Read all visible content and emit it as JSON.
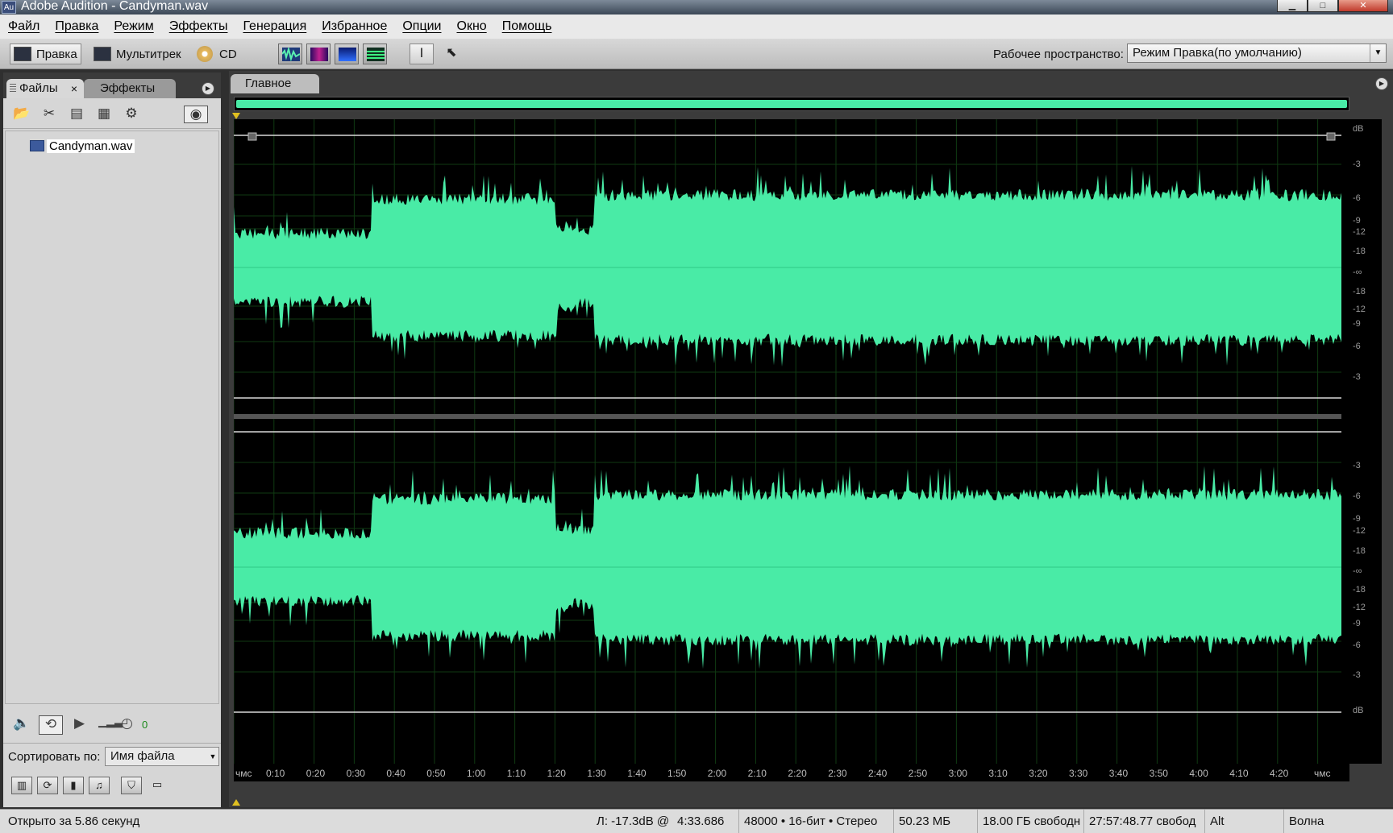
{
  "window": {
    "app_icon": "Au",
    "title": "Adobe Audition - Candyman.wav"
  },
  "menu": [
    "Файл",
    "Правка",
    "Режим",
    "Эффекты",
    "Генерация",
    "Избранное",
    "Опции",
    "Окно",
    "Помощь"
  ],
  "toolbar": {
    "mode_edit": "Правка",
    "mode_multitrack": "Мультитрек",
    "mode_cd": "CD",
    "view_icons": [
      "waveform-view-icon",
      "spectral-frequency-view-icon",
      "spectral-pan-view-icon",
      "spectral-phase-view-icon"
    ],
    "tools": [
      "time-selection-tool-icon",
      "marquee-selection-tool-icon"
    ],
    "workspace_label": "Рабочее пространство:",
    "workspace_value": "Режим Правка(по умолчанию)"
  },
  "left_panel": {
    "tabs": [
      "Файлы",
      "Эффекты"
    ],
    "files_close": "×",
    "file_toolbar_icons": [
      "open-file-icon",
      "close-file-icon",
      "insert-multitrack-icon",
      "insert-cd-icon",
      "edit-file-icon",
      "autoplay-toggle-icon"
    ],
    "files": [
      {
        "name": "Candyman.wav",
        "icon": "wav-file-icon"
      }
    ],
    "transport_level": "0",
    "sort_label": "Сортировать по:",
    "sort_value": "Имя файла"
  },
  "main_panel": {
    "tab": "Главное",
    "db_labels_top": [
      "dB",
      "-3",
      "-6",
      "-9",
      "-12",
      "-18",
      "-∞",
      "-18",
      "-12",
      "-9",
      "-6",
      "-3"
    ],
    "db_labels_bottom": [
      "-3",
      "-6",
      "-9",
      "-12",
      "-18",
      "-∞",
      "-18",
      "-12",
      "-9",
      "-6",
      "-3",
      "dB"
    ],
    "time_labels": [
      "чмс",
      "0:10",
      "0:20",
      "0:30",
      "0:40",
      "0:50",
      "1:00",
      "1:10",
      "1:20",
      "1:30",
      "1:40",
      "1:50",
      "2:00",
      "2:10",
      "2:20",
      "2:30",
      "2:40",
      "2:50",
      "3:00",
      "3:10",
      "3:20",
      "3:30",
      "3:40",
      "3:50",
      "4:00",
      "4:10",
      "4:20",
      "чмс"
    ],
    "waveform_color": "#49eba6"
  },
  "status": {
    "opened": "Открыто за 5.86 секунд",
    "level": "Л: -17.3dB @",
    "position": "4:33.686",
    "format": "48000 • 16-бит • Стерео",
    "size": "50.23 МБ",
    "disk_free": "18.00 ГБ свободн",
    "time_free": "27:57:48.77 свобод",
    "modifier": "Alt",
    "view": "Волна"
  }
}
